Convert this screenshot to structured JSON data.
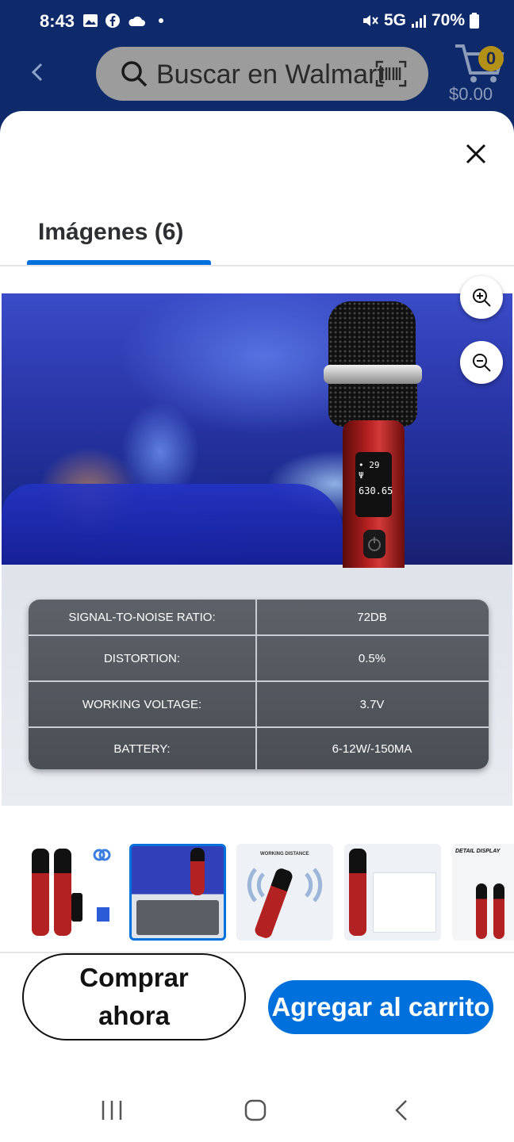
{
  "status_bar": {
    "time": "8:43",
    "network": "5G",
    "battery": "70%"
  },
  "header": {
    "search_placeholder": "Buscar en Walmart",
    "cart_count": "0",
    "cart_total": "$0.00"
  },
  "sheet": {
    "tab_label": "Imágenes (6)"
  },
  "main_image": {
    "specs": [
      {
        "label": "SIGNAL-TO-NOISE RATIO:",
        "value": "72DB"
      },
      {
        "label": "DISTORTION:",
        "value": "0.5%"
      },
      {
        "label": "WORKING VOLTAGE:",
        "value": "3.7V"
      },
      {
        "label": "BATTERY:",
        "value": "6-12W/-150MA"
      }
    ],
    "mic_screen": {
      "line1": "• 29 Ψ",
      "line2": "630.65"
    }
  },
  "thumbnails": {
    "count": 5,
    "selected_index": 1,
    "thumb3_caption": "WORKING DISTANCE",
    "thumb5_caption": "DETAIL DISPLAY"
  },
  "actions": {
    "buy_line1": "Comprar",
    "buy_line2": "ahora",
    "add_label": "Agregar al carrito"
  },
  "colors": {
    "header_bg": "#0f2a6b",
    "accent": "#0071dc",
    "cart_badge": "#b39117"
  }
}
